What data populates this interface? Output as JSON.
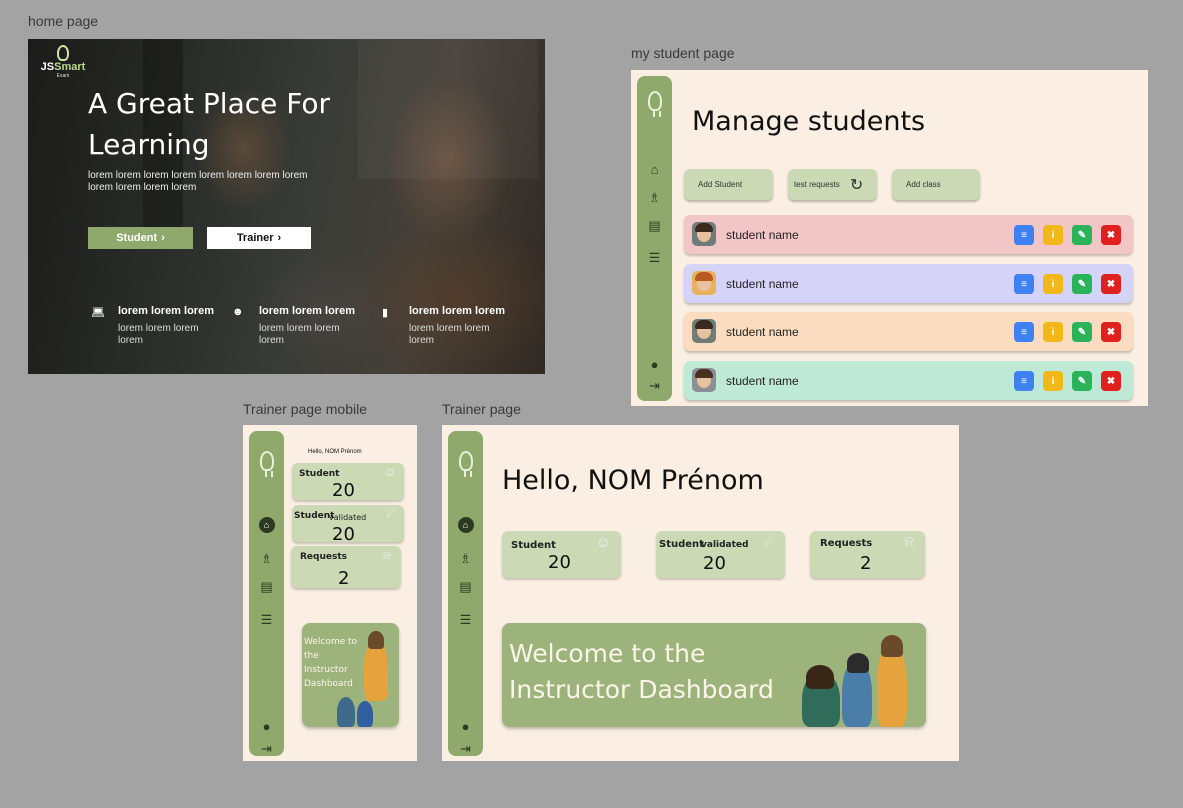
{
  "frames": {
    "home": "home page",
    "mystudent": "my student page",
    "trainer_mobile": "Trainer page mobile",
    "trainer": "Trainer page"
  },
  "home": {
    "logo": {
      "js": "JS",
      "smart": "Smart",
      "sub": "Exam"
    },
    "title": "A Great Place For Learning",
    "description": "lorem lorem lorem lorem lorem lorem lorem lorem lorem lorem lorem lorem",
    "student_button": "Student",
    "trainer_button": "Trainer",
    "features": [
      {
        "icon": "laptop-icon",
        "title": "lorem lorem lorem",
        "text": "lorem lorem lorem lorem"
      },
      {
        "icon": "users-icon",
        "title": "lorem lorem lorem",
        "text": "lorem lorem lorem lorem"
      },
      {
        "icon": "bookmark-icon",
        "title": "lorem lorem lorem",
        "text": "lorem lorem lorem lorem"
      }
    ]
  },
  "mystudent": {
    "title": "Manage students",
    "buttons": {
      "add_student": "Add Student",
      "test_requests": "test requests",
      "add_class": "Add class"
    },
    "students": [
      {
        "name": "student name",
        "color": "#f2c6c6"
      },
      {
        "name": "student name",
        "color": "#d5d3f8"
      },
      {
        "name": "student name",
        "color": "#fbdcc0"
      },
      {
        "name": "student name",
        "color": "#bde9d6"
      }
    ],
    "action_colors": {
      "report": "#3d82f0",
      "info": "#f2b81a",
      "edit": "#2bb35a",
      "delete": "#e0201d"
    }
  },
  "trainer_mobile": {
    "hello": "Hello, NOM Prénom",
    "cards": [
      {
        "label": "Student",
        "value": "20"
      },
      {
        "label": "Student",
        "sub": "validated",
        "value": "20"
      },
      {
        "label": "Requests",
        "value": "2"
      }
    ],
    "banner": "Welcome to the Instructor Dashboard"
  },
  "trainer": {
    "hello": "Hello, NOM Prénom",
    "cards": [
      {
        "label": "Student",
        "value": "20"
      },
      {
        "label": "Student",
        "sub": "validated",
        "value": "20"
      },
      {
        "label": "Requests",
        "value": "2"
      }
    ],
    "banner_line1": "Welcome to the",
    "banner_line2": "Instructor Dashboard"
  }
}
